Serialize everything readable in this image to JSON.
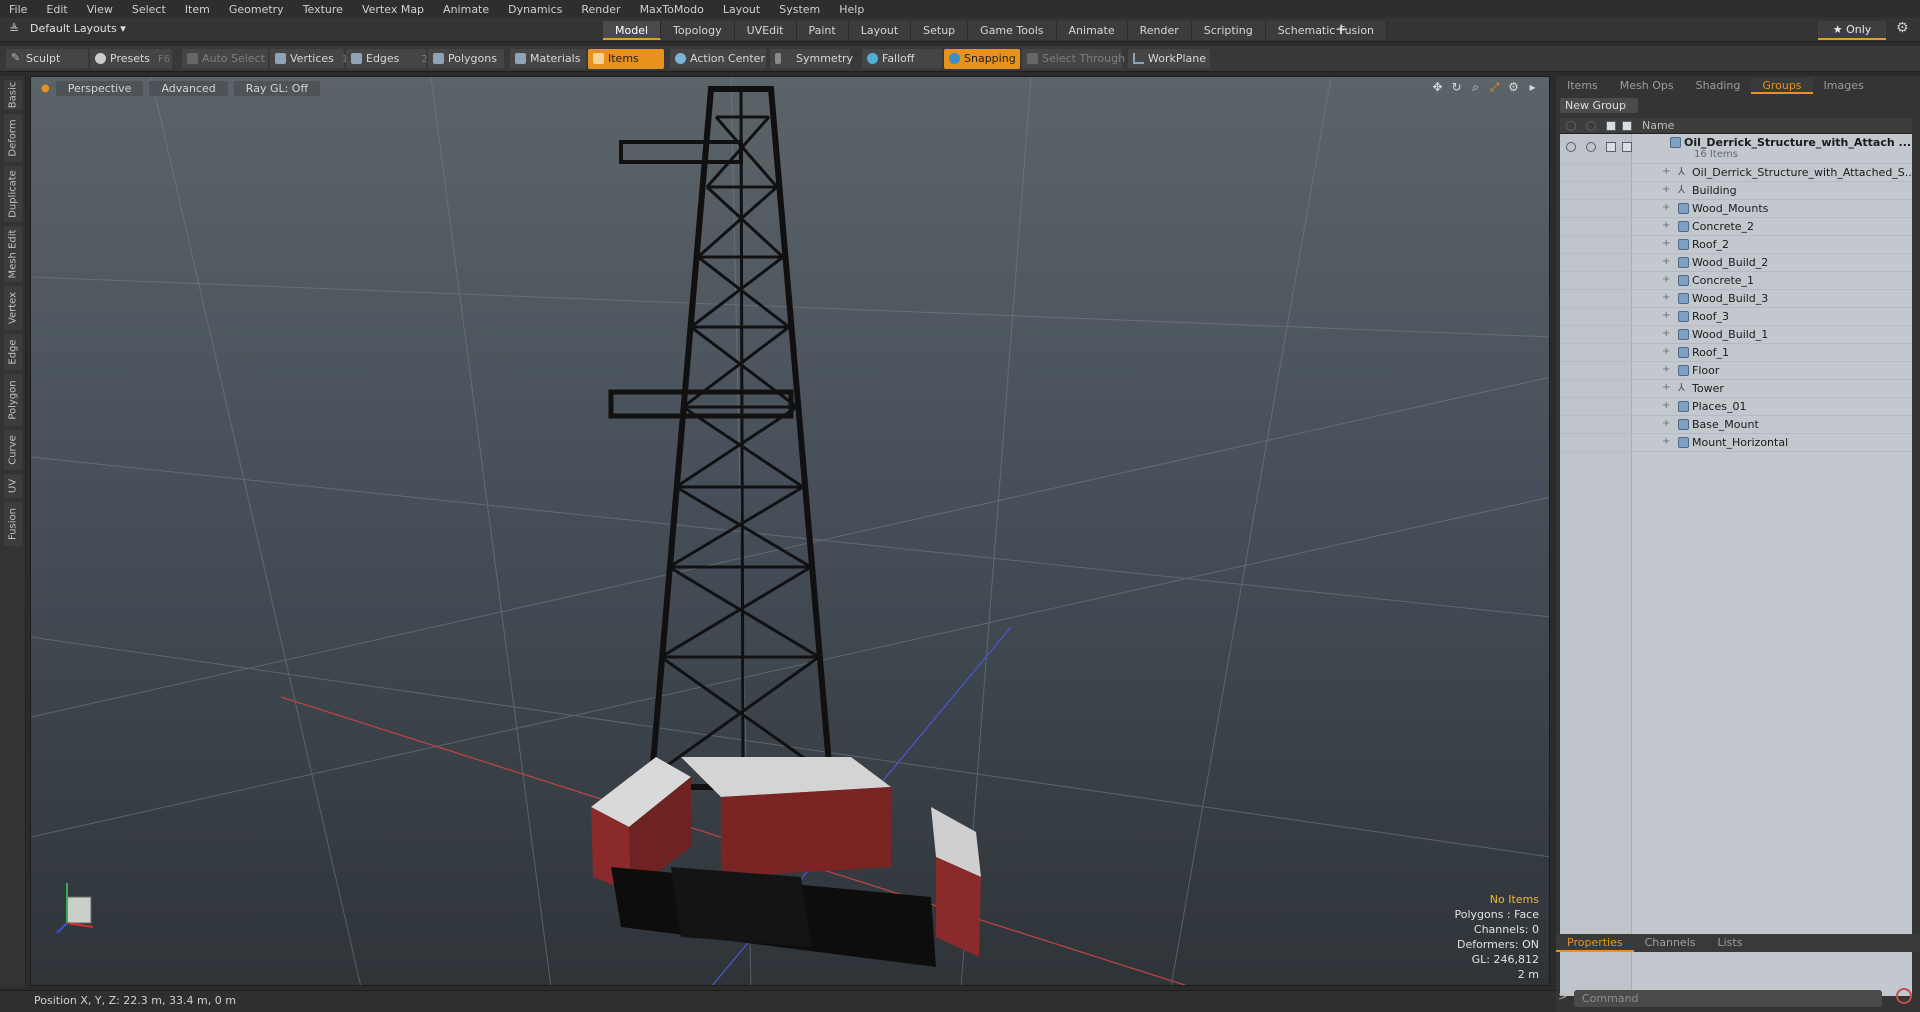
{
  "menu": [
    "File",
    "Edit",
    "View",
    "Select",
    "Item",
    "Geometry",
    "Texture",
    "Vertex Map",
    "Animate",
    "Dynamics",
    "Render",
    "MaxToModo",
    "Layout",
    "System",
    "Help"
  ],
  "layout": {
    "selector": "Default Layouts ▾",
    "only": "★  Only"
  },
  "tabs": [
    "Model",
    "Topology",
    "UVEdit",
    "Paint",
    "Layout",
    "Setup",
    "Game Tools",
    "Animate",
    "Render",
    "Scripting",
    "Schematic Fusion"
  ],
  "toolbar": {
    "sculpt": "Sculpt",
    "presets": "Presets",
    "presets_key": "F6",
    "auto_select": "Auto Select",
    "vertices": "Vertices",
    "vertices_count": "1",
    "edges": "Edges",
    "edges_count": "2",
    "polygons": "Polygons",
    "materials": "Materials",
    "items": "Items",
    "action_center": "Action Center",
    "symmetry": "Symmetry",
    "falloff": "Falloff",
    "snapping": "Snapping",
    "select_through": "Select Through",
    "workplane": "WorkPlane"
  },
  "left_tabs": [
    "Basic",
    "Deform",
    "Duplicate",
    "Mesh Edit",
    "Vertex",
    "Edge",
    "Polygon",
    "Curve",
    "UV",
    "Fusion"
  ],
  "viewport": {
    "view": "Perspective",
    "shading": "Advanced",
    "raygl": "Ray GL: Off",
    "info": {
      "selection": "No Items",
      "polygons": "Polygons : Face",
      "channels": "Channels: 0",
      "deformers": "Deformers: ON",
      "gl": "GL: 246,812",
      "scale": "2 m"
    }
  },
  "status": {
    "position": "Position X, Y, Z:   22.3 m, 33.4 m, 0 m"
  },
  "panel": {
    "tabs": [
      "Items",
      "Mesh Ops",
      "Shading",
      "Groups",
      "Images"
    ],
    "new_group": "New Group",
    "name_col": "Name",
    "root": {
      "name": "Oil_Derrick_Structure_with_Attach ...",
      "count": "16 Items"
    },
    "items": [
      "Oil_Derrick_Structure_with_Attached_S...",
      "Building",
      "Wood_Mounts",
      "Concrete_2",
      "Roof_2",
      "Wood_Build_2",
      "Concrete_1",
      "Wood_Build_3",
      "Roof_3",
      "Wood_Build_1",
      "Roof_1",
      "Floor",
      "Tower",
      "Places_01",
      "Base_Mount",
      "Mount_Horizontal"
    ],
    "bottom_tabs": [
      "Properties",
      "Channels",
      "Lists"
    ],
    "command_placeholder": "Command"
  },
  "colors": {
    "accent": "#e8921e",
    "list_bg": "#c3c8ce",
    "mesh_icon": "#7ea0c4"
  }
}
